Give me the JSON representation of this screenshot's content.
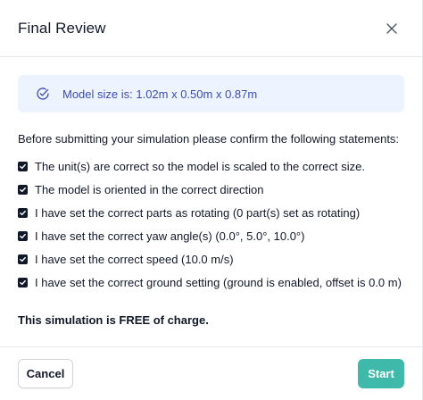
{
  "dialog": {
    "title": "Final Review",
    "close_icon": "close-icon"
  },
  "info": {
    "icon": "check-circle-icon",
    "text": "Model size is: 1.02m x 0.50m x 0.87m"
  },
  "intro": "Before submitting your simulation please confirm the following statements:",
  "statements": [
    {
      "label": "The unit(s) are correct so the model is scaled to the correct size.",
      "checked": true
    },
    {
      "label": "The model is oriented in the correct direction",
      "checked": true
    },
    {
      "label": "I have set the correct parts as rotating (0 part(s) set as rotating)",
      "checked": true
    },
    {
      "label": "I have set the correct yaw angle(s) (0.0°, 5.0°, 10.0°)",
      "checked": true
    },
    {
      "label": "I have set the correct speed (10.0 m/s)",
      "checked": true
    },
    {
      "label": "I have set the correct ground setting (ground is enabled, offset is 0.0 m)",
      "checked": true
    }
  ],
  "free_notice": "This simulation is FREE of charge.",
  "footer": {
    "cancel_label": "Cancel",
    "start_label": "Start"
  },
  "colors": {
    "accent": "#3fb9a9",
    "info_bg": "#eef4ff",
    "info_text": "#3b4bb0"
  }
}
